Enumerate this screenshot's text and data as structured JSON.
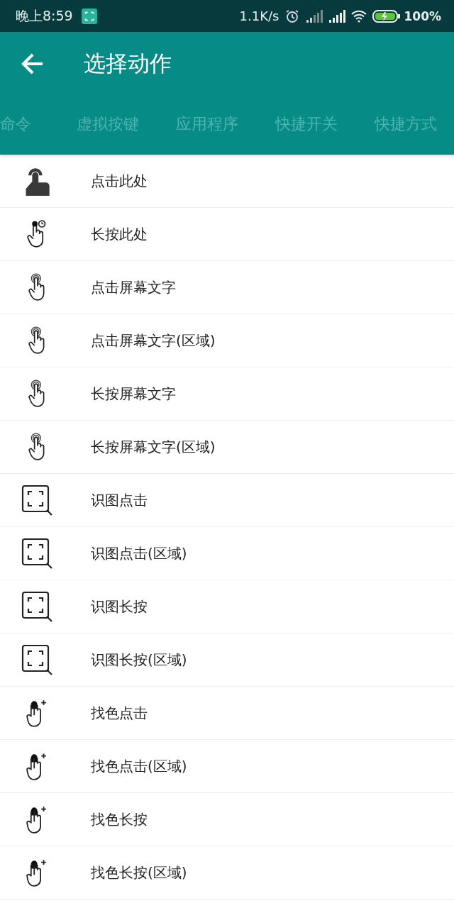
{
  "status_bar": {
    "time": "晚上8:59",
    "net_speed": "1.1K/s",
    "battery": "100%"
  },
  "toolbar": {
    "title": "选择动作"
  },
  "tabs": [
    {
      "label": "命令",
      "selected": false
    },
    {
      "label": "虚拟按键",
      "selected": false
    },
    {
      "label": "应用程序",
      "selected": false
    },
    {
      "label": "快捷开关",
      "selected": false
    },
    {
      "label": "快捷方式",
      "selected": false
    }
  ],
  "actions": [
    {
      "label": "点击此处",
      "kind": "tap"
    },
    {
      "label": "长按此处",
      "kind": "hold"
    },
    {
      "label": "点击屏幕文字",
      "kind": "text"
    },
    {
      "label": "点击屏幕文字(区域)",
      "kind": "text"
    },
    {
      "label": "长按屏幕文字",
      "kind": "text"
    },
    {
      "label": "长按屏幕文字(区域)",
      "kind": "text"
    },
    {
      "label": "识图点击",
      "kind": "image"
    },
    {
      "label": "识图点击(区域)",
      "kind": "image"
    },
    {
      "label": "识图长按",
      "kind": "image"
    },
    {
      "label": "识图长按(区域)",
      "kind": "image"
    },
    {
      "label": "找色点击",
      "kind": "color"
    },
    {
      "label": "找色点击(区域)",
      "kind": "color"
    },
    {
      "label": "找色长按",
      "kind": "color"
    },
    {
      "label": "找色长按(区域)",
      "kind": "color"
    }
  ]
}
